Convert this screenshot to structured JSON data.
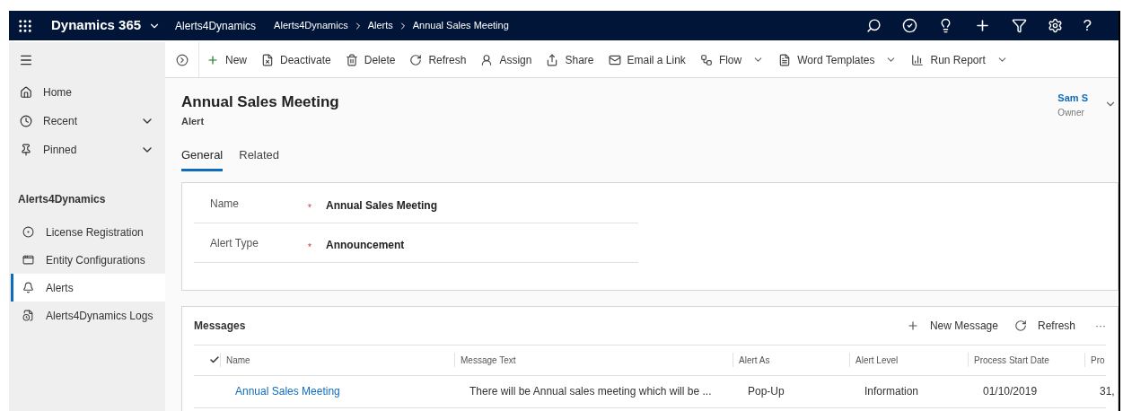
{
  "top_bar": {
    "app_name": "Dynamics 365",
    "area": "Alerts4Dynamics",
    "breadcrumb": [
      "Alerts4Dynamics",
      "Alerts",
      "Annual Sales Meeting"
    ],
    "help": "?"
  },
  "sidebar": {
    "items": [
      {
        "label": "Home",
        "kind": "link",
        "selected": false
      },
      {
        "label": "Recent",
        "kind": "group",
        "selected": false
      },
      {
        "label": "Pinned",
        "kind": "group",
        "selected": false
      }
    ],
    "section_title": "Alerts4Dynamics",
    "section_items": [
      {
        "label": "License Registration",
        "selected": false
      },
      {
        "label": "Entity Configurations",
        "selected": false
      },
      {
        "label": "Alerts",
        "selected": true
      },
      {
        "label": "Alerts4Dynamics Logs",
        "selected": false
      }
    ]
  },
  "command_bar": [
    {
      "label": "New",
      "dropdown": false
    },
    {
      "label": "Deactivate",
      "dropdown": false
    },
    {
      "label": "Delete",
      "dropdown": false
    },
    {
      "label": "Refresh",
      "dropdown": false
    },
    {
      "label": "Assign",
      "dropdown": false
    },
    {
      "label": "Share",
      "dropdown": false
    },
    {
      "label": "Email a Link",
      "dropdown": false
    },
    {
      "label": "Flow",
      "dropdown": true
    },
    {
      "label": "Word Templates",
      "dropdown": true
    },
    {
      "label": "Run Report",
      "dropdown": true
    }
  ],
  "record": {
    "title": "Annual Sales Meeting",
    "entity": "Alert",
    "owner_name": "Sam S",
    "owner_label": "Owner"
  },
  "tabs": [
    {
      "label": "General",
      "selected": true
    },
    {
      "label": "Related",
      "selected": false
    }
  ],
  "fields": [
    {
      "label": "Name",
      "required_mark": "*",
      "value": "Annual Sales Meeting"
    },
    {
      "label": "Alert Type",
      "required_mark": "*",
      "value": "Announcement"
    }
  ],
  "messages": {
    "title": "Messages",
    "actions": [
      "New Message",
      "Refresh"
    ],
    "more": "···",
    "columns": [
      "Name",
      "Message Text",
      "Alert As",
      "Alert Level",
      "Process Start Date",
      "Pro"
    ],
    "rows": [
      [
        "Annual Sales Meeting",
        "There will be Annual sales meeting which will be ...",
        "Pop-Up",
        "Information",
        "01/10/2019",
        "31,"
      ]
    ]
  }
}
